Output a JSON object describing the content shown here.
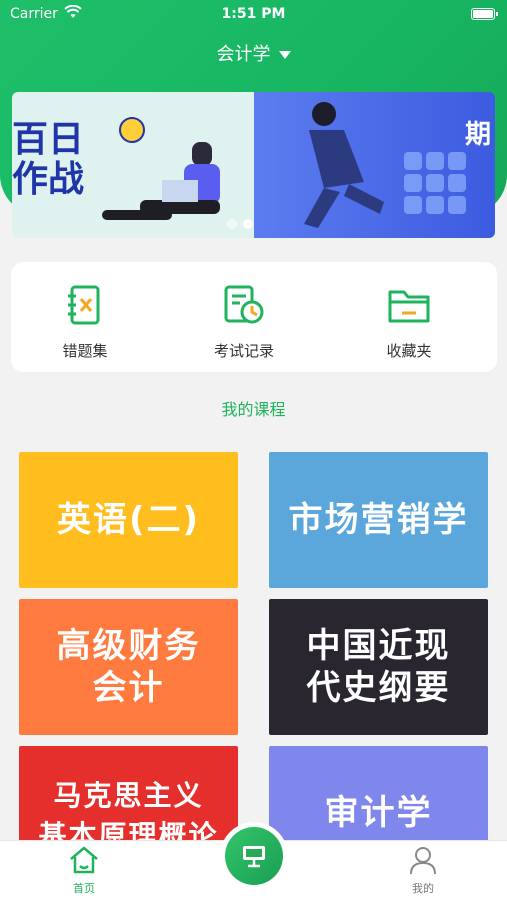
{
  "status_bar": {
    "carrier": "Carrier",
    "time": "1:51 PM"
  },
  "header": {
    "subject": "会计学"
  },
  "banner": {
    "slide1_text": "百日\n作战",
    "slide2_text": "期"
  },
  "shortcuts": [
    {
      "label": "错题集",
      "icon": "notebook-x-icon"
    },
    {
      "label": "考试记录",
      "icon": "clock-document-icon"
    },
    {
      "label": "收藏夹",
      "icon": "folder-icon"
    }
  ],
  "section_title": "我的课程",
  "courses": [
    {
      "title": "英语(二)"
    },
    {
      "title": "市场营销学"
    },
    {
      "title": "高级财务\n会计"
    },
    {
      "title": "中国近现\n代史纲要"
    },
    {
      "title": "马克思主义\n基本原理概论"
    },
    {
      "title": "审计学"
    }
  ],
  "tabbar": {
    "home": "首页",
    "mine": "我的"
  },
  "colors": {
    "accent": "#1fb35c"
  }
}
